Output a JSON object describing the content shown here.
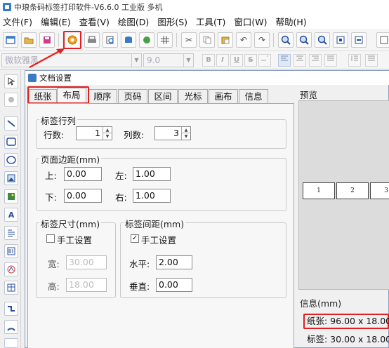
{
  "app": {
    "title": "中琅条码标签打印软件-V6.6.0 工业版 多机"
  },
  "menu": [
    "文件(F)",
    "编辑(E)",
    "查看(V)",
    "绘图(D)",
    "图形(S)",
    "工具(T)",
    "窗口(W)",
    "帮助(H)"
  ],
  "format_bar": {
    "font_name": "微软雅黑",
    "font_size": "9.0",
    "bold": "B",
    "italic": "I",
    "underline": "U",
    "strike": "S"
  },
  "dialog": {
    "title": "文档设置",
    "tabs": [
      "纸张",
      "布局",
      "顺序",
      "页码",
      "区间",
      "光标",
      "画布",
      "信息"
    ],
    "active_tab": "布局",
    "rows_cols": {
      "title": "标签行列",
      "rows_label": "行数:",
      "rows_value": "1",
      "cols_label": "列数:",
      "cols_value": "3"
    },
    "margins": {
      "title": "页面边距(mm)",
      "top_label": "上:",
      "top_value": "0.00",
      "left_label": "左:",
      "left_value": "1.00",
      "bottom_label": "下:",
      "bottom_value": "0.00",
      "right_label": "右:",
      "right_value": "1.00"
    },
    "label_size": {
      "title": "标签尺寸(mm)",
      "manual_label": "手工设置",
      "manual_checked": false,
      "width_label": "宽:",
      "width_value": "30.00",
      "height_label": "高:",
      "height_value": "18.00"
    },
    "label_gap": {
      "title": "标签间距(mm)",
      "manual_label": "手工设置",
      "manual_checked": true,
      "h_label": "水平:",
      "h_value": "2.00",
      "v_label": "垂直:",
      "v_value": "0.00"
    },
    "preview": {
      "title": "预览",
      "labels": [
        "1",
        "2",
        "3"
      ]
    },
    "info": {
      "title": "信息(mm)",
      "paper": "纸张: 96.00 x 18.00",
      "label": "标签: 30.00 x 18.00"
    }
  },
  "colors": {
    "highlight": "#e02020",
    "accent": "#3a79c8"
  }
}
